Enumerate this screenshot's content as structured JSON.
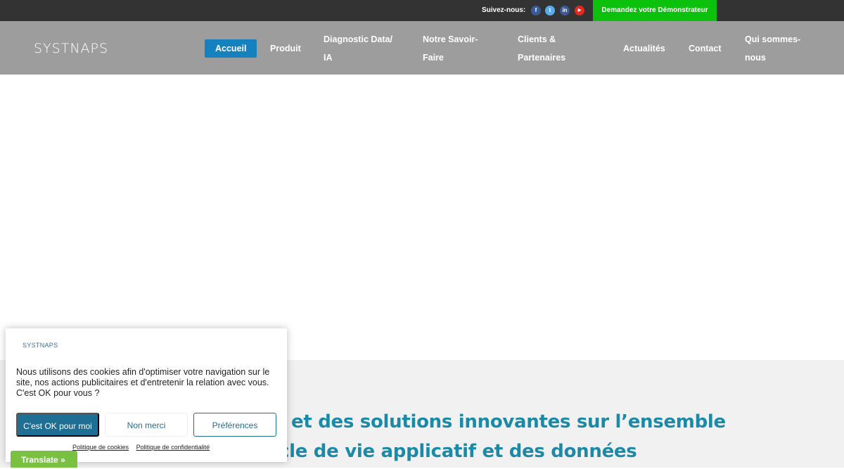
{
  "topbar": {
    "follow_label": "Suivez-nous:",
    "social": [
      {
        "icon": "facebook-icon",
        "glyph": "f",
        "color": "#3b5998"
      },
      {
        "icon": "twitter-icon",
        "glyph": "t",
        "color": "#55acee"
      },
      {
        "icon": "linkedin-icon",
        "glyph": "in",
        "color": "#3b5998"
      },
      {
        "icon": "youtube-icon",
        "glyph": "▶",
        "color": "#e02a20"
      }
    ],
    "demo_button": "Demandez votre Démonstrateur"
  },
  "nav": {
    "logo": "SYSTNAPS",
    "items": [
      "Accueil",
      "Produit",
      "Diagnostic Data/",
      "IA",
      "Notre Savoir-",
      "Faire",
      "Clients &",
      "Partenaires",
      "Actualités",
      "Contact",
      "Qui sommes-",
      "nous"
    ]
  },
  "hero": {
    "line1": "et des solutions innovantes sur l’ensemble",
    "line2": "cle de vie applicatif et des données"
  },
  "cookie": {
    "logo": "SYSTNAPS",
    "text": "Nous utilisons des cookies afin d'optimiser votre navigation sur le site, nos actions publicitaires et d'entretenir la relation avec vous. C'est OK pour vous ?",
    "accept": "C'est OK pour moi",
    "decline": "Non merci",
    "preferences": "Préférences",
    "cookie_policy": "Politique de cookies",
    "privacy_policy": "Politique de confidentialité"
  },
  "translate": "Translate »"
}
